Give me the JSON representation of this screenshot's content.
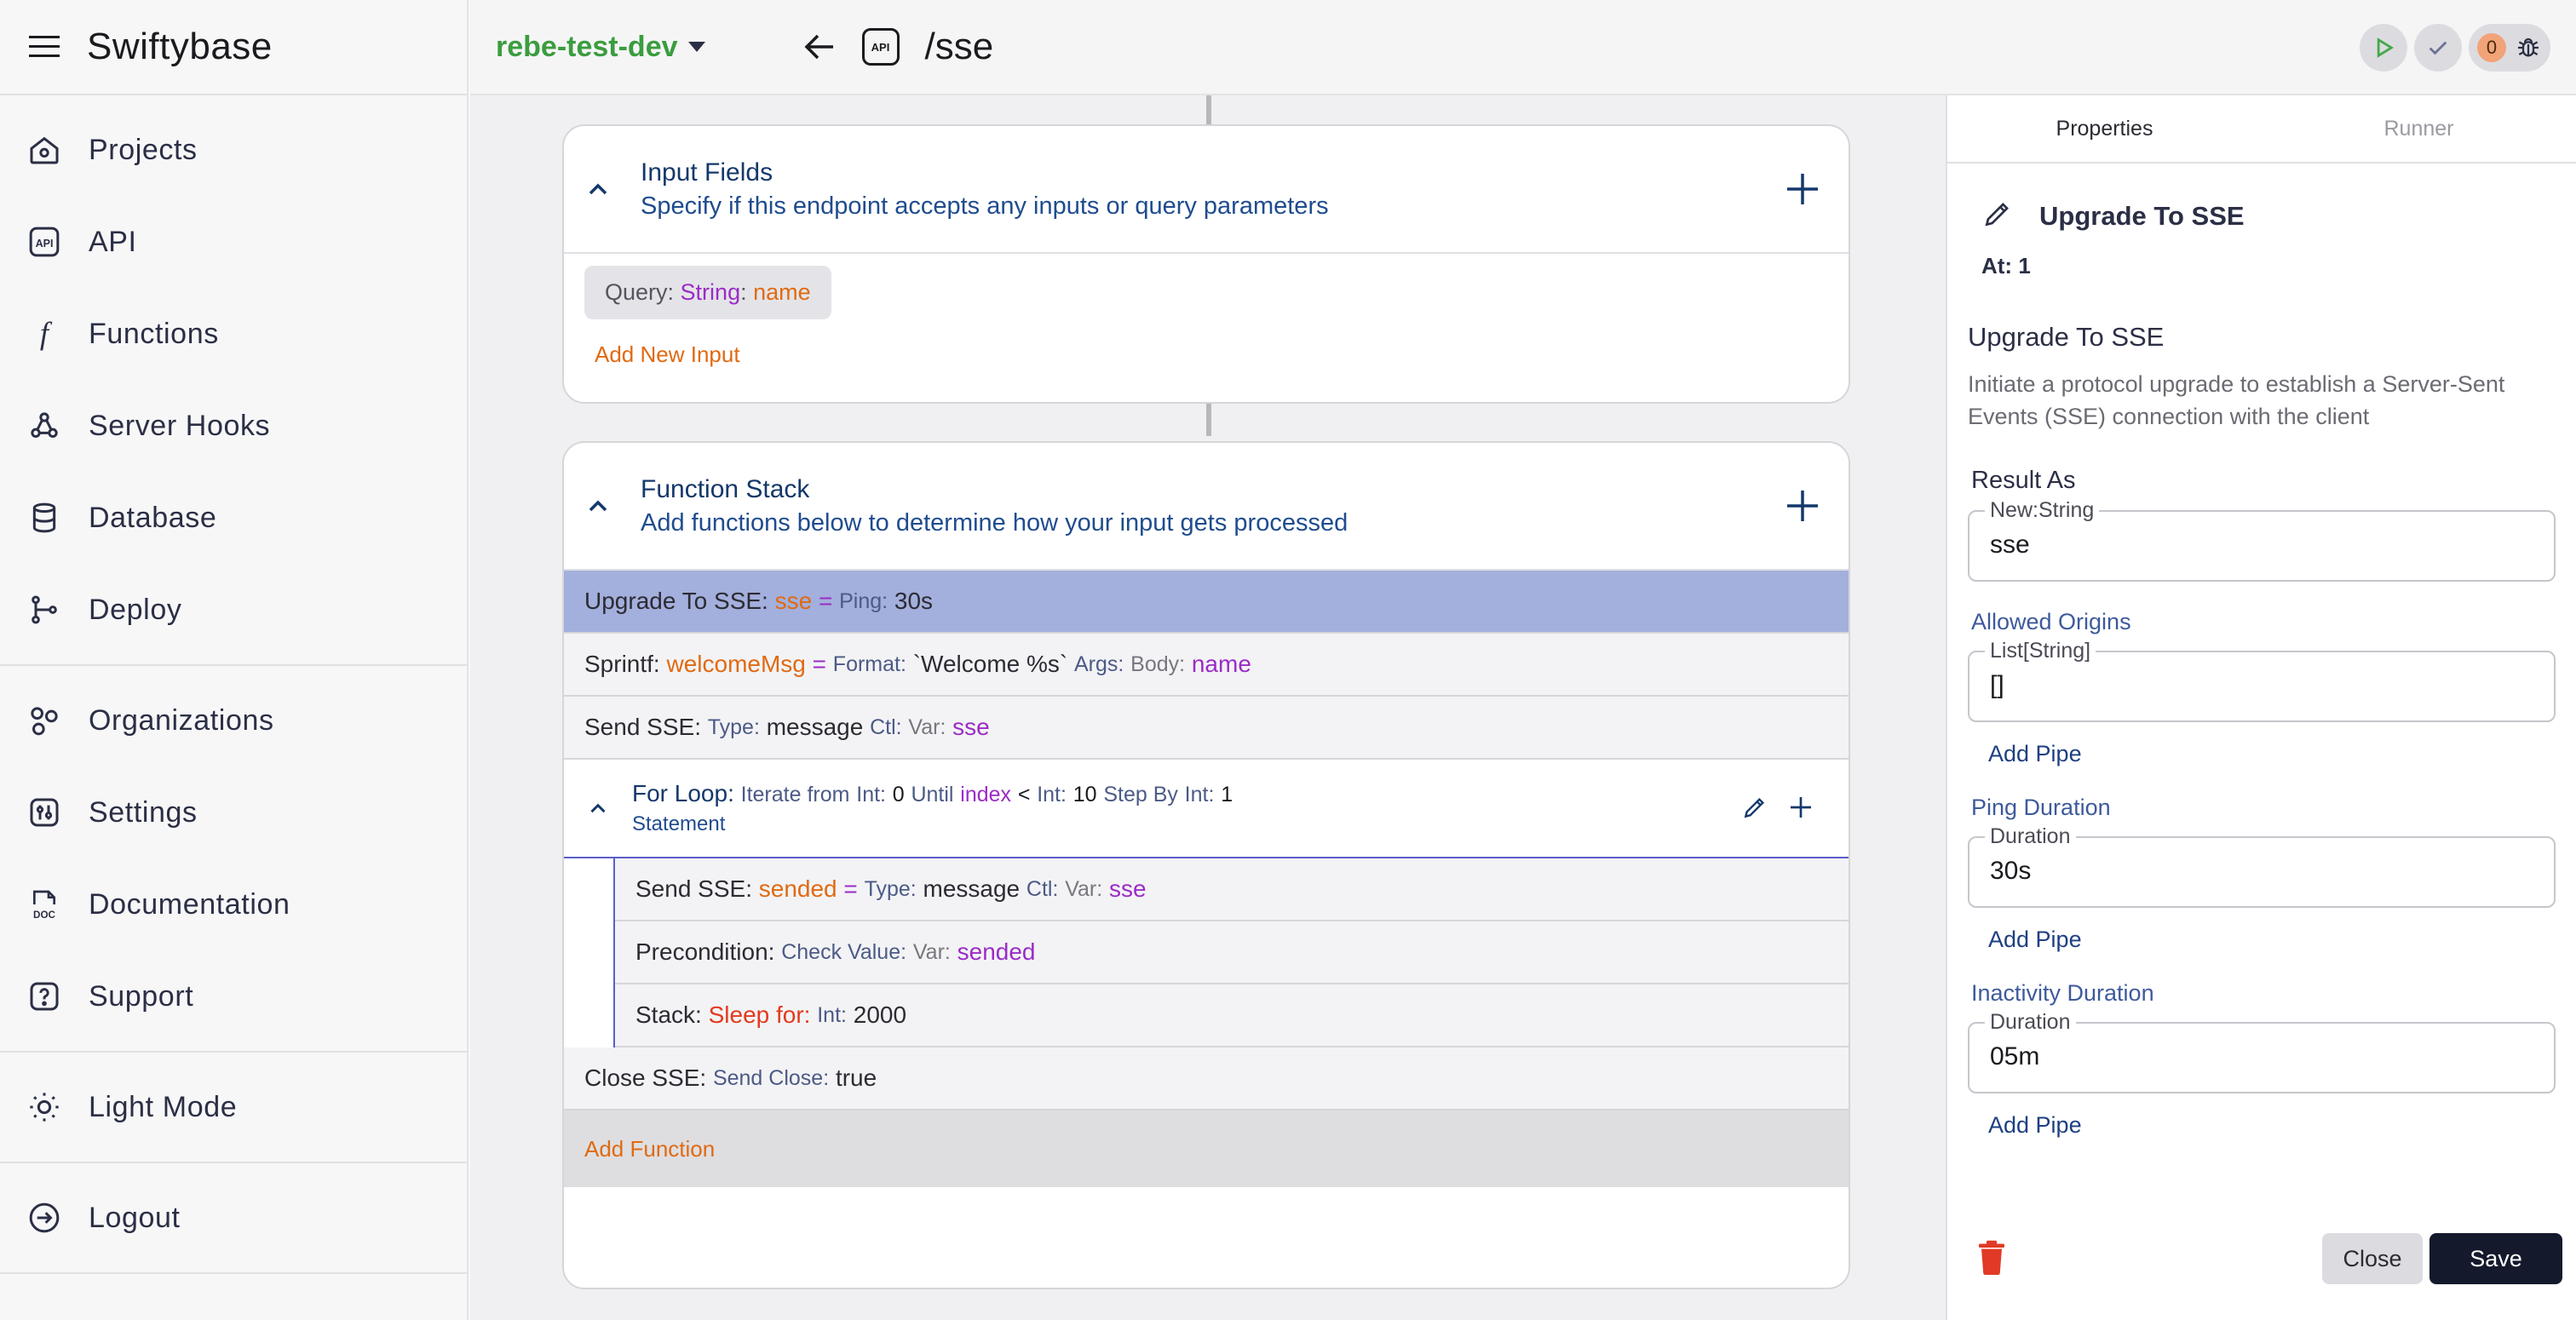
{
  "app": {
    "title": "Swiftybase"
  },
  "sidebar": {
    "groups": [
      [
        {
          "label": "Projects",
          "icon": "home-icon"
        },
        {
          "label": "API",
          "icon": "api-icon"
        },
        {
          "label": "Functions",
          "icon": "function-icon"
        },
        {
          "label": "Server Hooks",
          "icon": "webhook-icon"
        },
        {
          "label": "Database",
          "icon": "database-icon"
        },
        {
          "label": "Deploy",
          "icon": "git-branch-icon"
        }
      ],
      [
        {
          "label": "Organizations",
          "icon": "shapes-icon"
        },
        {
          "label": "Settings",
          "icon": "settings-icon"
        },
        {
          "label": "Documentation",
          "icon": "doc-icon"
        },
        {
          "label": "Support",
          "icon": "help-icon"
        }
      ],
      [
        {
          "label": "Light Mode",
          "icon": "sun-icon"
        }
      ],
      [
        {
          "label": "Logout",
          "icon": "logout-icon"
        }
      ]
    ]
  },
  "topbar": {
    "project": "rebe-test-dev",
    "api_badge": "API",
    "route": "/sse",
    "counter": "0"
  },
  "input_fields": {
    "title": "Input Fields",
    "subtitle": "Specify if this endpoint accepts any inputs or query parameters",
    "chip": {
      "kind": "Query",
      "type": "String",
      "name": "name"
    },
    "add_label": "Add New Input"
  },
  "function_stack": {
    "title": "Function Stack",
    "subtitle": "Add functions below to determine how your input gets processed",
    "rows": {
      "upgrade": {
        "fn": "Upgrade To SSE:",
        "var": "sse",
        "eq": "=",
        "key": "Ping:",
        "val": "30s"
      },
      "sprintf": {
        "fn": "Sprintf:",
        "var": "welcomeMsg",
        "eq": "=",
        "k1": "Format:",
        "v1": "`Welcome %s`",
        "k2": "Args:",
        "k3": "Body:",
        "v3": "name"
      },
      "send": {
        "fn": "Send SSE:",
        "k1": "Type:",
        "v1": "message",
        "k2": "Ctl:",
        "k3": "Var:",
        "v3": "sse"
      }
    },
    "loop": {
      "fn": "For Loop:",
      "iter": "Iterate from",
      "k_int1": "Int:",
      "v_int1": "0",
      "until": "Until",
      "index": "index",
      "lt": "<",
      "k_int2": "Int:",
      "v_int2": "10",
      "step": "Step By",
      "k_int3": "Int:",
      "v_int3": "1",
      "statement": "Statement"
    },
    "loop_rows": {
      "send2": {
        "fn": "Send SSE:",
        "var": "sended",
        "eq": "=",
        "k1": "Type:",
        "v1": "message",
        "k2": "Ctl:",
        "k3": "Var:",
        "v3": "sse"
      },
      "pre": {
        "fn": "Precondition:",
        "k1": "Check Value:",
        "k2": "Var:",
        "v2": "sended"
      },
      "stack": {
        "fn": "Stack:",
        "k1": "Sleep for:",
        "k2": "Int:",
        "v2": "2000"
      }
    },
    "close": {
      "fn": "Close SSE:",
      "k1": "Send Close:",
      "v1": "true"
    },
    "add_label": "Add Function"
  },
  "panel": {
    "tabs": [
      "Properties",
      "Runner"
    ],
    "head_title": "Upgrade To SSE",
    "at": "At: 1",
    "desc_title": "Upgrade To SSE",
    "desc": "Initiate a protocol upgrade to establish a Server-Sent Events (SSE) connection with the client",
    "result_label": "Result As",
    "result_legend": "New:String",
    "result_value": "sse",
    "origins_label": "Allowed Origins",
    "origins_legend": "List[String]",
    "origins_value": "[]",
    "ping_label": "Ping Duration",
    "ping_legend": "Duration",
    "ping_value": "30s",
    "inactivity_label": "Inactivity Duration",
    "inactivity_legend": "Duration",
    "inactivity_value": "05m",
    "add_pipe": "Add Pipe",
    "close_label": "Close",
    "save_label": "Save"
  },
  "colors": {
    "accent_green": "#3a9d3e",
    "active_row": "#a3afdc",
    "orange": "#e06a12",
    "purple": "#9b2cc6"
  }
}
